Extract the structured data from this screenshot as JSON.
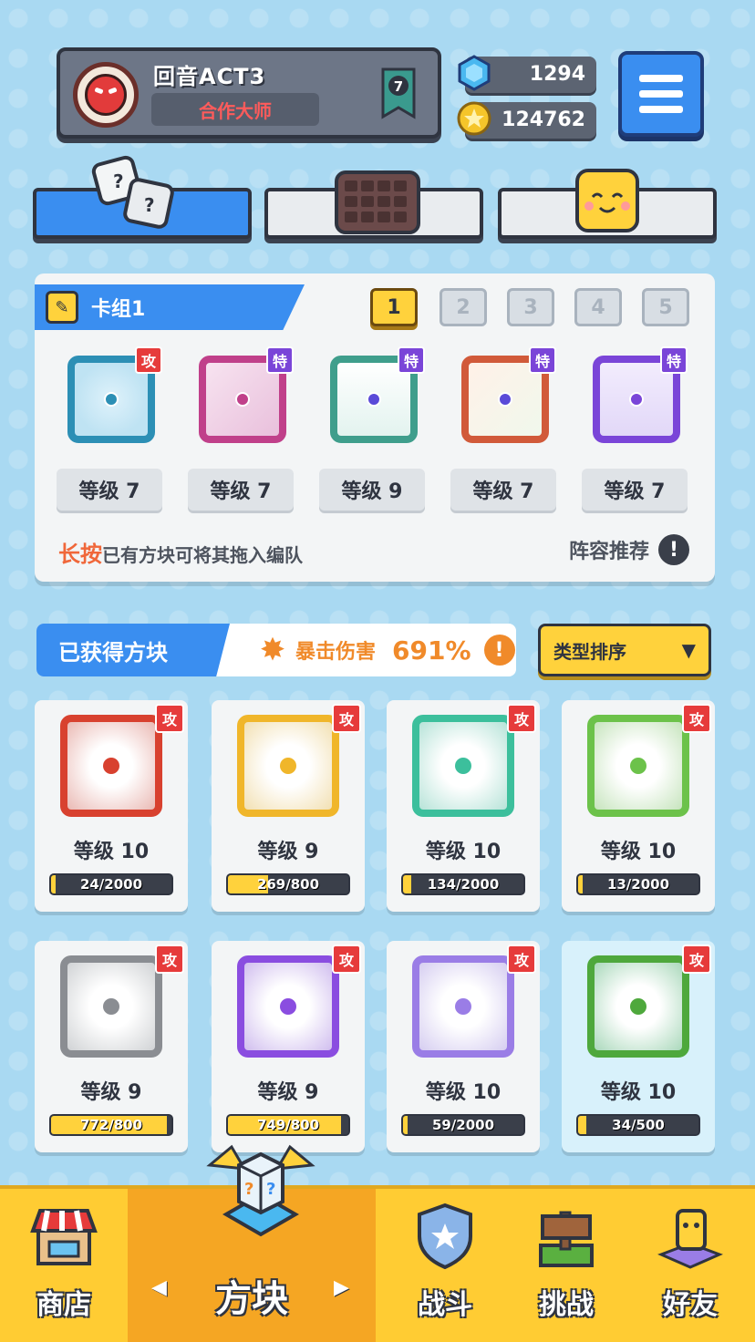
{
  "profile": {
    "name": "回音ACT3",
    "title": "合作大师",
    "rank": "7"
  },
  "currency": {
    "gems": "1294",
    "coins": "124762"
  },
  "deck": {
    "name": "卡组1",
    "numbers": [
      "1",
      "2",
      "3",
      "4",
      "5"
    ],
    "selected": "1",
    "cards": [
      {
        "tag": "攻",
        "level": "等级 7",
        "color": "#2c8fb5"
      },
      {
        "tag": "特",
        "level": "等级 7",
        "color": "#c0408a"
      },
      {
        "tag": "特",
        "level": "等级 9",
        "color": "#3f9e8c"
      },
      {
        "tag": "特",
        "level": "等级 7",
        "color": "#d15a3a"
      },
      {
        "tag": "特",
        "level": "等级 7",
        "color": "#7a45d8"
      }
    ],
    "hint_highlight": "长按",
    "hint_text": "已有方块可将其拖入编队",
    "recommend": "阵容推荐",
    "recommend_icon": "!"
  },
  "obtained": {
    "title": "已获得方块",
    "crit_label": "暴击伤害",
    "crit_value": "691%",
    "crit_icon": "!",
    "sort_label": "类型排序",
    "sort_arrow": "▼"
  },
  "blocks": [
    {
      "tag": "攻",
      "level": "等级 10",
      "progress": "24/2000",
      "fill": 0.012,
      "color": "#d8412f"
    },
    {
      "tag": "攻",
      "level": "等级 9",
      "progress": "269/800",
      "fill": 0.336,
      "color": "#f0b62a"
    },
    {
      "tag": "攻",
      "level": "等级 10",
      "progress": "134/2000",
      "fill": 0.067,
      "color": "#3cbf9c"
    },
    {
      "tag": "攻",
      "level": "等级 10",
      "progress": "13/2000",
      "fill": 0.007,
      "color": "#6cc24a"
    },
    {
      "tag": "攻",
      "level": "等级 9",
      "progress": "772/800",
      "fill": 0.965,
      "color": "#8a8d92"
    },
    {
      "tag": "攻",
      "level": "等级 9",
      "progress": "749/800",
      "fill": 0.936,
      "color": "#8a4de0"
    },
    {
      "tag": "攻",
      "level": "等级 10",
      "progress": "59/2000",
      "fill": 0.03,
      "color": "#9a7de6"
    },
    {
      "tag": "攻",
      "level": "等级 10",
      "progress": "34/500",
      "fill": 0.068,
      "color": "#4ea83c"
    }
  ],
  "nav": {
    "shop": "商店",
    "blocks": "方块",
    "battle": "战斗",
    "challenge": "挑战",
    "friends": "好友",
    "arrow_left": "◀",
    "arrow_right": "▶"
  },
  "colors": {
    "accent_blue": "#3a8ef0",
    "accent_yellow": "#ffd23c",
    "attack_red": "#e63b3b",
    "special_purple": "#7a45d8",
    "crit_orange": "#f08a2a"
  }
}
